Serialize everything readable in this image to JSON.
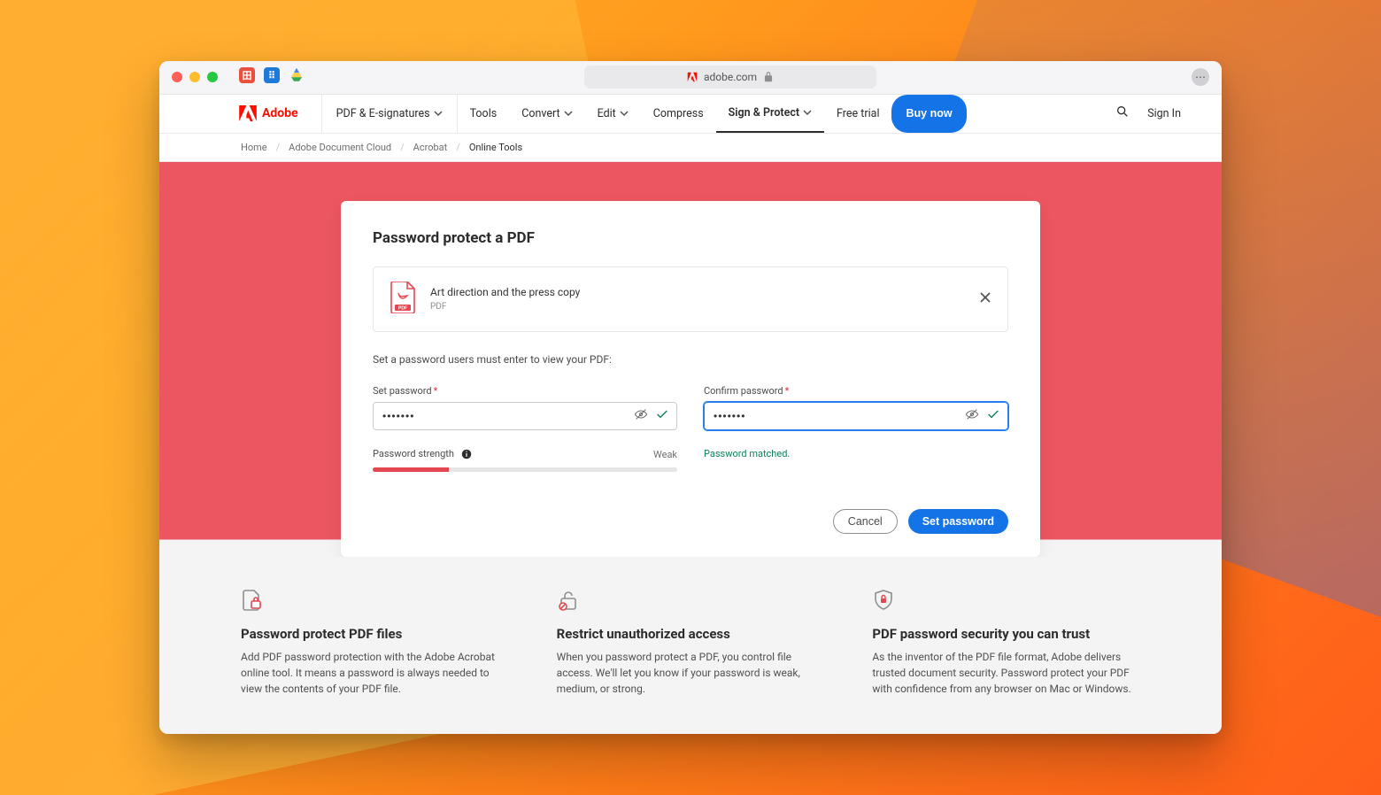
{
  "browser": {
    "address": "adobe.com"
  },
  "brand": {
    "name": "Adobe"
  },
  "nav": {
    "product_dropdown": "PDF & E-signatures",
    "items": {
      "tools": "Tools",
      "convert": "Convert",
      "edit": "Edit",
      "compress": "Compress",
      "sign_protect": "Sign & Protect",
      "free_trial": "Free trial"
    },
    "buy_now": "Buy now",
    "sign_in": "Sign In"
  },
  "breadcrumb": {
    "home": "Home",
    "adoc": "Adobe Document Cloud",
    "acrobat": "Acrobat",
    "current": "Online Tools"
  },
  "card": {
    "title": "Password protect a PDF",
    "file": {
      "name": "Art direction and the press copy",
      "type": "PDF"
    },
    "instruction": "Set a password users must enter to view your PDF:",
    "set_label": "Set password",
    "confirm_label": "Confirm password",
    "required_mark": "*",
    "set_value": "•••••••",
    "confirm_value": "•••••••",
    "strength_label": "Password strength",
    "strength_level": "Weak",
    "matched_msg": "Password matched.",
    "cancel": "Cancel",
    "submit": "Set password"
  },
  "features": {
    "a": {
      "title": "Password protect PDF files",
      "body": "Add PDF password protection with the Adobe Acrobat online tool. It means a password is always needed to view the contents of your PDF file."
    },
    "b": {
      "title": "Restrict unauthorized access",
      "body": "When you password protect a PDF, you control file access. We'll let you know if your password is weak, medium, or strong."
    },
    "c": {
      "title": "PDF password security you can trust",
      "body": "As the inventor of the PDF file format, Adobe delivers trusted document security. Password protect your PDF with confidence from any browser on Mac or Windows."
    }
  }
}
